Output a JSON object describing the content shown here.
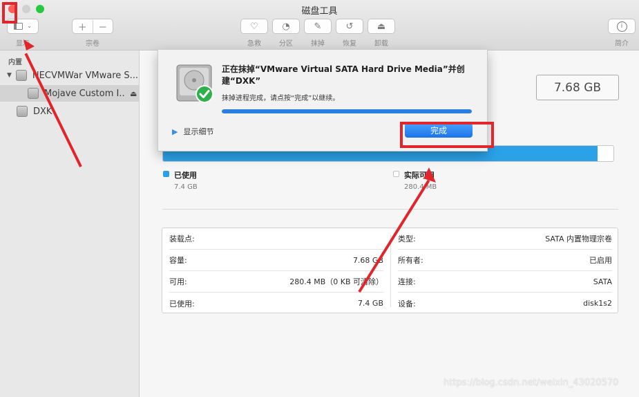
{
  "window": {
    "title": "磁盘工具"
  },
  "toolbar": {
    "view_label": "显示",
    "volume_label": "宗卷",
    "firstaid_label": "急救",
    "partition_label": "分区",
    "erase_label": "抹掉",
    "restore_label": "恢复",
    "unmount_label": "卸载",
    "info_label": "简介"
  },
  "sidebar": {
    "section": "内置",
    "items": [
      {
        "label": "NECVMWar VMware S..."
      },
      {
        "label": "Mojave Custom I..."
      },
      {
        "label": "DXK"
      }
    ]
  },
  "main": {
    "size": "7.68 GB",
    "usage_fraction": 0.964,
    "used_title": "已使用",
    "used_value": "7.4 GB",
    "available_title": "实际可用",
    "available_value": "280.4 MB",
    "colors": {
      "used": "#2ba2e8",
      "accent": "#1a73e8",
      "annotation": "#e0262b"
    }
  },
  "info": {
    "left": [
      {
        "key": "装载点:",
        "value": ""
      },
      {
        "key": "容量:",
        "value": "7.68 GB"
      },
      {
        "key": "可用:",
        "value": "280.4 MB（0 KB 可清除）"
      },
      {
        "key": "已使用:",
        "value": "7.4 GB"
      }
    ],
    "right": [
      {
        "key": "类型:",
        "value": "SATA 内置物理宗卷"
      },
      {
        "key": "所有者:",
        "value": "已启用"
      },
      {
        "key": "连接:",
        "value": "SATA"
      },
      {
        "key": "设备:",
        "value": "disk1s2"
      }
    ]
  },
  "sheet": {
    "title": "正在抹掉“VMware Virtual SATA Hard Drive Media”并创建“DXK”",
    "status": "抹掉进程完成，请点按“完成”以继续。",
    "progress_fraction": 1.0,
    "details_label": "显示细节",
    "done_label": "完成"
  },
  "watermark": "https://blog.csdn.net/weixin_43020570"
}
